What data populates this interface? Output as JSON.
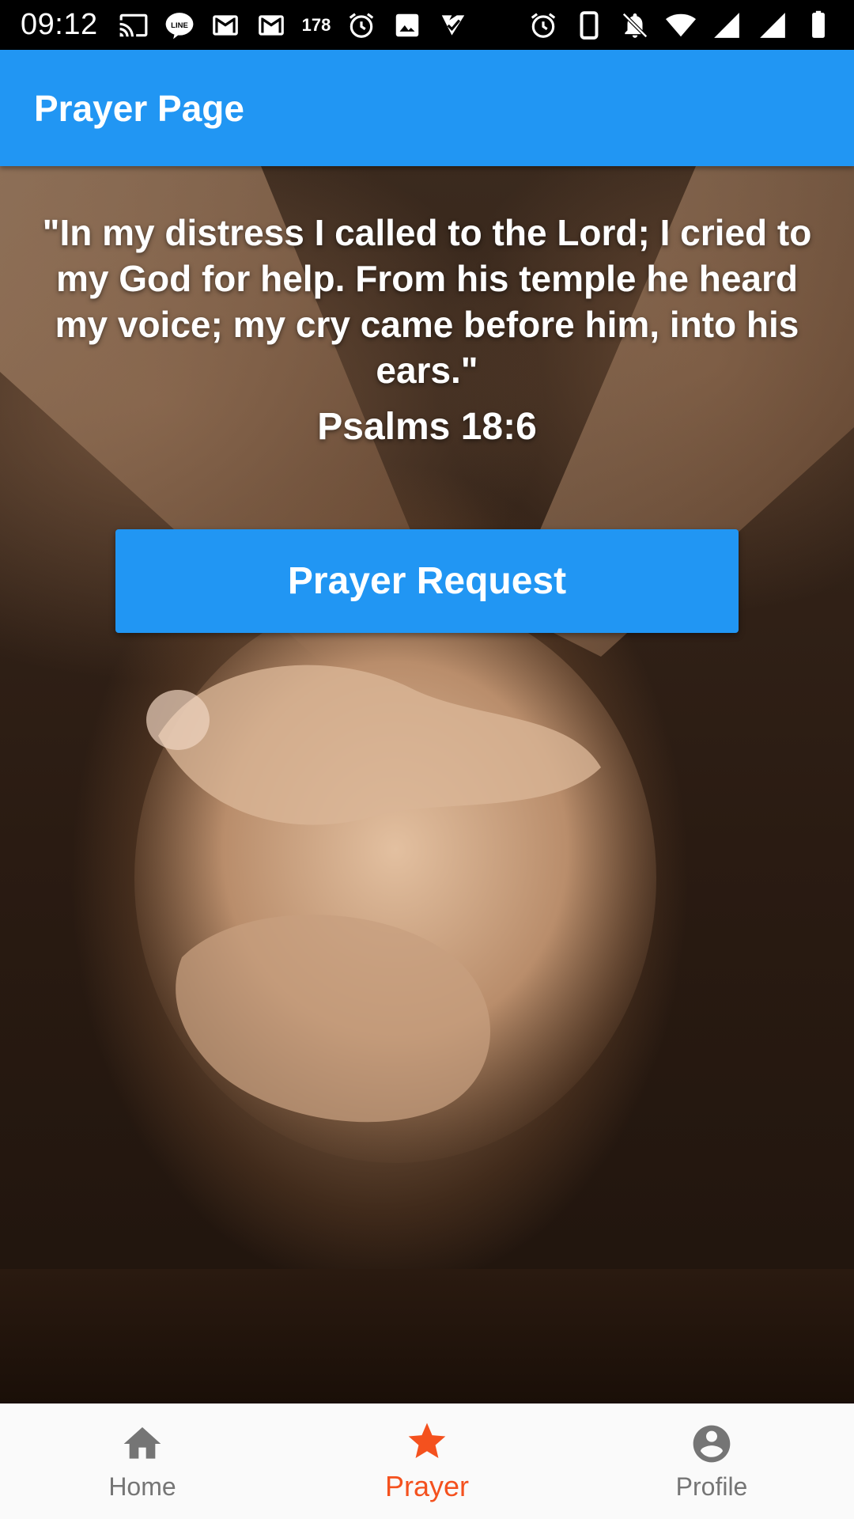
{
  "status_bar": {
    "time": "09:12",
    "badge_count": "178",
    "left_icons": [
      "cast-icon",
      "line-icon",
      "gmail-icon",
      "gmail-icon",
      "alarm-icon",
      "image-icon",
      "check-icon"
    ],
    "right_icons": [
      "alarm-icon",
      "phone-icon",
      "bell-off-icon",
      "wifi-icon",
      "signal-icon",
      "signal-icon",
      "battery-icon"
    ]
  },
  "app_bar": {
    "title": "Prayer Page",
    "color": "#2196F3"
  },
  "main": {
    "verse": "\"In my distress I called to the Lord; I cried to my God for help. From his temple he heard my voice; my cry came before him, into his ears.\"",
    "reference": "Psalms 18:6",
    "button_label": "Prayer Request",
    "background_image": "clasped-hands-photo"
  },
  "bottom_nav": {
    "items": [
      {
        "label": "Home",
        "icon": "home-icon",
        "active": false
      },
      {
        "label": "Prayer",
        "icon": "star-icon",
        "active": true
      },
      {
        "label": "Profile",
        "icon": "account-circle-icon",
        "active": false
      }
    ],
    "active_color": "#F4511E",
    "inactive_color": "#757575"
  }
}
